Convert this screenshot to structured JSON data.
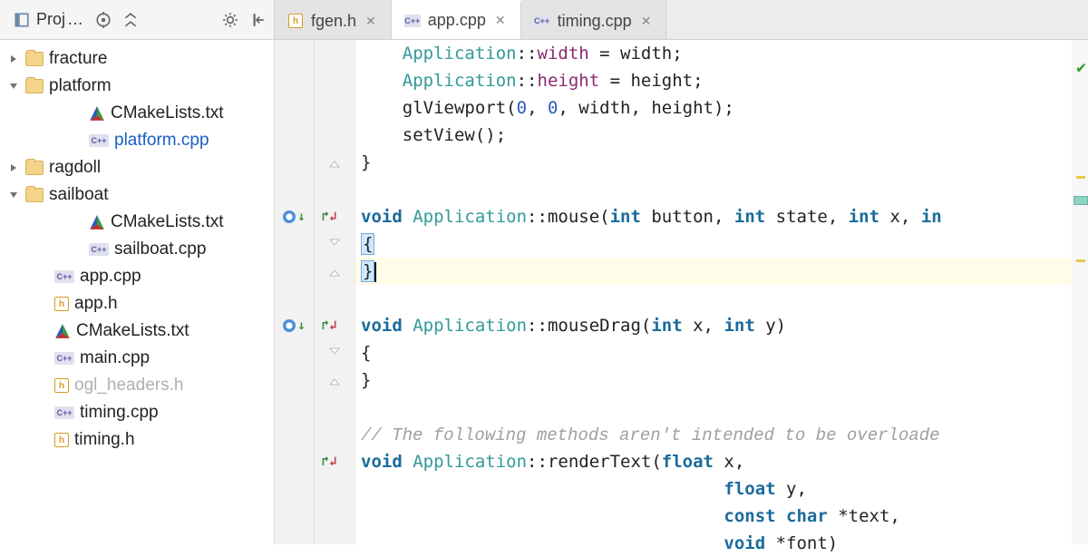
{
  "project_panel": {
    "title": "Proj"
  },
  "tabs": [
    {
      "icon": "h",
      "label": "fgen.h",
      "active": false
    },
    {
      "icon": "cpp",
      "label": "app.cpp",
      "active": true
    },
    {
      "icon": "cpp",
      "label": "timing.cpp",
      "active": false
    }
  ],
  "tree": {
    "items": [
      {
        "level": 1,
        "arrow": "right",
        "icon": "folder",
        "label": "fracture"
      },
      {
        "level": 1,
        "arrow": "down",
        "icon": "folder",
        "label": "platform"
      },
      {
        "level": 3,
        "arrow": "",
        "icon": "cmake",
        "label": "CMakeLists.txt"
      },
      {
        "level": 3,
        "arrow": "",
        "icon": "cpp",
        "label": "platform.cpp",
        "color": "blue"
      },
      {
        "level": 1,
        "arrow": "right",
        "icon": "folder",
        "label": "ragdoll"
      },
      {
        "level": 1,
        "arrow": "down",
        "icon": "folder",
        "label": "sailboat"
      },
      {
        "level": 3,
        "arrow": "",
        "icon": "cmake",
        "label": "CMakeLists.txt"
      },
      {
        "level": 3,
        "arrow": "",
        "icon": "cpp",
        "label": "sailboat.cpp"
      },
      {
        "level": 2,
        "arrow": "",
        "icon": "cpp",
        "label": "app.cpp"
      },
      {
        "level": 2,
        "arrow": "",
        "icon": "h",
        "label": "app.h"
      },
      {
        "level": 2,
        "arrow": "",
        "icon": "cmake",
        "label": "CMakeLists.txt"
      },
      {
        "level": 2,
        "arrow": "",
        "icon": "cpp",
        "label": "main.cpp"
      },
      {
        "level": 2,
        "arrow": "",
        "icon": "h",
        "label": "ogl_headers.h",
        "color": "muted"
      },
      {
        "level": 2,
        "arrow": "",
        "icon": "cpp",
        "label": "timing.cpp"
      },
      {
        "level": 2,
        "arrow": "",
        "icon": "h",
        "label": "timing.h"
      }
    ]
  },
  "code": {
    "lines": [
      {
        "indent": 4,
        "tokens": [
          [
            "cls",
            "Application"
          ],
          [
            "scope",
            "::"
          ],
          [
            "member",
            "width"
          ],
          [
            "txt",
            " = width;"
          ]
        ]
      },
      {
        "indent": 4,
        "tokens": [
          [
            "cls",
            "Application"
          ],
          [
            "scope",
            "::"
          ],
          [
            "member",
            "height"
          ],
          [
            "txt",
            " = height;"
          ]
        ]
      },
      {
        "indent": 4,
        "tokens": [
          [
            "fn",
            "glViewport("
          ],
          [
            "num",
            "0"
          ],
          [
            "txt",
            ", "
          ],
          [
            "num",
            "0"
          ],
          [
            "txt",
            ", width, height);"
          ]
        ]
      },
      {
        "indent": 4,
        "tokens": [
          [
            "fn",
            "setView();"
          ]
        ]
      },
      {
        "indent": 0,
        "tokens": [
          [
            "txt",
            "}"
          ]
        ],
        "fold_end": true
      },
      {
        "indent": 0,
        "tokens": []
      },
      {
        "indent": 0,
        "tokens": [
          [
            "kw-void",
            "void "
          ],
          [
            "cls",
            "Application"
          ],
          [
            "scope",
            "::"
          ],
          [
            "fn",
            "mouse"
          ],
          [
            "txt",
            "("
          ],
          [
            "kw-type",
            "int"
          ],
          [
            "txt",
            " button, "
          ],
          [
            "kw-type",
            "int"
          ],
          [
            "txt",
            " state, "
          ],
          [
            "kw-type",
            "int"
          ],
          [
            "txt",
            " x, "
          ],
          [
            "kw-type",
            "in"
          ]
        ],
        "override": true
      },
      {
        "indent": 0,
        "tokens": [
          [
            "brace-hl",
            "{"
          ]
        ],
        "fold_start": true
      },
      {
        "indent": 0,
        "tokens": [
          [
            "brace-hl",
            "}"
          ]
        ],
        "fold_end": true,
        "hl": true,
        "caret": true
      },
      {
        "indent": 0,
        "tokens": []
      },
      {
        "indent": 0,
        "tokens": [
          [
            "kw-void",
            "void "
          ],
          [
            "cls",
            "Application"
          ],
          [
            "scope",
            "::"
          ],
          [
            "fn",
            "mouseDrag"
          ],
          [
            "txt",
            "("
          ],
          [
            "kw-type",
            "int"
          ],
          [
            "txt",
            " x, "
          ],
          [
            "kw-type",
            "int"
          ],
          [
            "txt",
            " y)"
          ]
        ],
        "override": true
      },
      {
        "indent": 0,
        "tokens": [
          [
            "txt",
            "{"
          ]
        ],
        "fold_start": true
      },
      {
        "indent": 0,
        "tokens": [
          [
            "txt",
            "}"
          ]
        ],
        "fold_end": true
      },
      {
        "indent": 0,
        "tokens": []
      },
      {
        "indent": 0,
        "tokens": [
          [
            "comment",
            "// The following methods aren't intended to be overloade"
          ]
        ]
      },
      {
        "indent": 0,
        "tokens": [
          [
            "kw-void",
            "void "
          ],
          [
            "cls",
            "Application"
          ],
          [
            "scope",
            "::"
          ],
          [
            "fn",
            "renderText"
          ],
          [
            "txt",
            "("
          ],
          [
            "kw-type",
            "float"
          ],
          [
            "txt",
            " x,"
          ]
        ],
        "nav": true
      },
      {
        "indent": 35,
        "tokens": [
          [
            "kw-type",
            "float"
          ],
          [
            "txt",
            " y,"
          ]
        ]
      },
      {
        "indent": 35,
        "tokens": [
          [
            "kw-type",
            "const char"
          ],
          [
            "txt",
            " *text,"
          ]
        ]
      },
      {
        "indent": 35,
        "tokens": [
          [
            "kw-type",
            "void"
          ],
          [
            "txt",
            " *font)"
          ]
        ]
      }
    ]
  }
}
